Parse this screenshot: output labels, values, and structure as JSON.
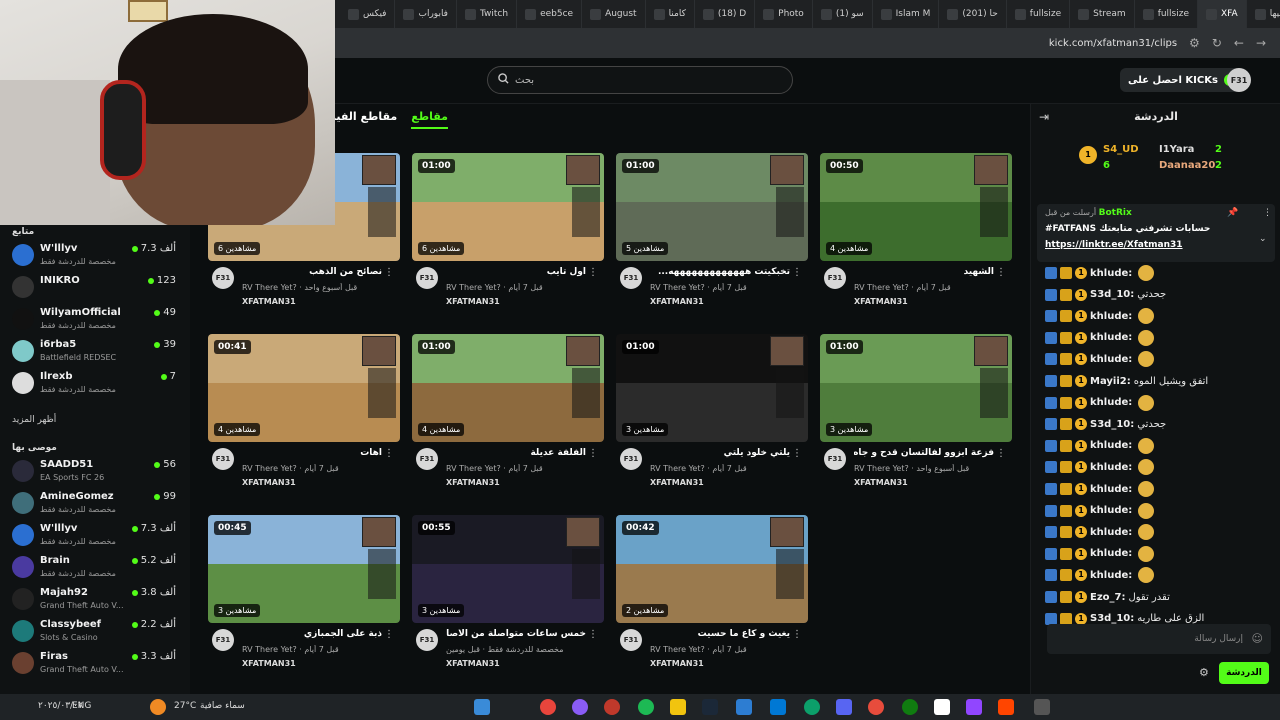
{
  "browser": {
    "tabs": [
      "فيكس",
      "فابوراب",
      "Twitch",
      "eeb5ce",
      "August",
      "كامنا",
      "(18) D",
      "Photo",
      "(1) سو",
      "Islam M",
      "(201) حا",
      "fullsize",
      "Stream",
      "fullsize",
      "XFA",
      "التنبيها"
    ],
    "url": "kick.com/xfatman31/clips"
  },
  "header": {
    "search_placeholder": "بحث",
    "get_kicks_label": "احصل على KICKs",
    "avatar_text": "F31"
  },
  "main": {
    "tab_clips": "مقاطع",
    "tab_other": "مقاطع الفيد"
  },
  "clips": [
    {
      "duration": "",
      "views": "6 مشاهدين",
      "title": "نصائح من الذهب",
      "game": "RV There Yet?",
      "time": "قبل أسبوع واحد",
      "channel": "XFATMAN31"
    },
    {
      "duration": "01:00",
      "views": "6 مشاهدين",
      "title": "اول تايب",
      "game": "RV There Yet?",
      "time": "قبل 7 أيام",
      "channel": "XFATMAN31"
    },
    {
      "duration": "01:00",
      "views": "5 مشاهدين",
      "title": "تخبكيتت هههههههههههههه...",
      "game": "RV There Yet?",
      "time": "قبل 7 أيام",
      "channel": "XFATMAN31"
    },
    {
      "duration": "00:50",
      "views": "4 مشاهدين",
      "title": "الشهيد",
      "game": "RV There Yet?",
      "time": "قبل 7 أيام",
      "channel": "XFATMAN31"
    },
    {
      "duration": "00:41",
      "views": "4 مشاهدين",
      "title": "آهات",
      "game": "RV There Yet?",
      "time": "قبل 7 أيام",
      "channel": "XFATMAN31"
    },
    {
      "duration": "01:00",
      "views": "4 مشاهدين",
      "title": "الفلفة عديلة",
      "game": "RV There Yet?",
      "time": "قبل 7 أيام",
      "channel": "XFATMAN31"
    },
    {
      "duration": "01:00",
      "views": "3 مشاهدين",
      "title": "يلتي خلود يلتي",
      "game": "RV There Yet?",
      "time": "قبل 7 أيام",
      "channel": "XFATMAN31"
    },
    {
      "duration": "01:00",
      "views": "3 مشاهدين",
      "title": "فزعة ابزوو لفالتسان قدح و جاه ال...",
      "game": "RV There Yet?",
      "time": "قبل أسبوع واحد",
      "channel": "XFATMAN31"
    },
    {
      "duration": "00:45",
      "views": "3 مشاهدين",
      "title": "ذبة على الجمبازي",
      "game": "RV There Yet?",
      "time": "قبل 7 أيام",
      "channel": "XFATMAN31"
    },
    {
      "duration": "00:55",
      "views": "3 مشاهدين",
      "title": "خمس ساعات متواصلة من الاصامو...",
      "game": "مخصصة للدردشة فقط",
      "time": "قبل يومين",
      "channel": "XFATMAN31"
    },
    {
      "duration": "00:42",
      "views": "2 مشاهدين",
      "title": "يغيث و كاع ما حسيت",
      "game": "RV There Yet?",
      "time": "قبل 7 أيام",
      "channel": "XFATMAN31"
    }
  ],
  "sidebar": {
    "following_title": "متابع",
    "following": [
      {
        "name": "W'lllyv",
        "sub": "مخصصة للدردشة فقط",
        "viewers": "7.3 ألف",
        "color": "#2b6fd1"
      },
      {
        "name": "INIKRO",
        "sub": "",
        "viewers": "123",
        "color": "#333333"
      },
      {
        "name": "WilyamOfficial",
        "sub": "مخصصة للدردشة فقط",
        "viewers": "49",
        "color": "#111111"
      },
      {
        "name": "i6rba5",
        "sub": "Battlefield REDSEC",
        "viewers": "39",
        "color": "#7fc9c9"
      },
      {
        "name": "Ilrexb",
        "sub": "مخصصة للدردشة فقط",
        "viewers": "7",
        "color": "#dddddd"
      }
    ],
    "show_more": "أظهر المزيد",
    "recommended_title": "موصى بها",
    "recommended": [
      {
        "name": "SAADD51",
        "sub": "EA Sports FC 26",
        "viewers": "56",
        "color": "#2a2a3a"
      },
      {
        "name": "AmineGomez",
        "sub": "مخصصة للدردشة فقط",
        "viewers": "99",
        "color": "#3f6e7a"
      },
      {
        "name": "W'lllyv",
        "sub": "مخصصة للدردشة فقط",
        "viewers": "7.3 ألف",
        "color": "#2b6fd1"
      },
      {
        "name": "Brain",
        "sub": "مخصصة للدردشة فقط",
        "viewers": "5.2 ألف",
        "color": "#4a3aa0"
      },
      {
        "name": "Majah92",
        "sub": "Grand Theft Auto V...",
        "viewers": "3.8 ألف",
        "color": "#222222"
      },
      {
        "name": "Classybeef",
        "sub": "Slots & Casino",
        "viewers": "2.2 ألف",
        "color": "#1d7a7a"
      },
      {
        "name": "Firas",
        "sub": "Grand Theft Auto V...",
        "viewers": "3.3 ألف",
        "color": "#6a4030"
      }
    ]
  },
  "chat": {
    "title": "الدردشة",
    "leaderboard": {
      "first_name": "S4_UD",
      "first_score": "6",
      "second_name": "I1Yara",
      "second_score": "2",
      "third_name": "Daanaa20",
      "third_score": "2"
    },
    "pinned": {
      "pinned_by": "أرسلت من قبل",
      "user": "BotRix",
      "text": "#FATFANS حسابات تشرفني متابعتك",
      "link": "https://linktr.ee/Xfatman31"
    },
    "messages": [
      {
        "user": "khlude:",
        "text": ""
      },
      {
        "user": "S3d_10:",
        "text": "جحدتي"
      },
      {
        "user": "khlude:",
        "text": ""
      },
      {
        "user": "khlude:",
        "text": ""
      },
      {
        "user": "khlude:",
        "text": ""
      },
      {
        "user": "Mayii2:",
        "text": "اتفق ويشيل الموه"
      },
      {
        "user": "khlude:",
        "text": ""
      },
      {
        "user": "S3d_10:",
        "text": "جحدتي"
      },
      {
        "user": "khlude:",
        "text": ""
      },
      {
        "user": "khlude:",
        "text": ""
      },
      {
        "user": "khlude:",
        "text": ""
      },
      {
        "user": "khlude:",
        "text": ""
      },
      {
        "user": "khlude:",
        "text": ""
      },
      {
        "user": "khlude:",
        "text": ""
      },
      {
        "user": "khlude:",
        "text": ""
      },
      {
        "user": "Ezo_7:",
        "text": "تقدر تقول"
      },
      {
        "user": "S3d_10:",
        "text": "الزق على طاريه"
      }
    ],
    "input_placeholder": "إرسال رسالة",
    "send_label": "الدردشة"
  },
  "taskbar": {
    "lang": "ENG",
    "weather": "27°C",
    "weather_desc": "سماء صافية",
    "date": "٢٠٢٥/٠٣/٠٧"
  },
  "colors": {
    "accent": "#53fc18",
    "bg": "#0b0e0f"
  }
}
